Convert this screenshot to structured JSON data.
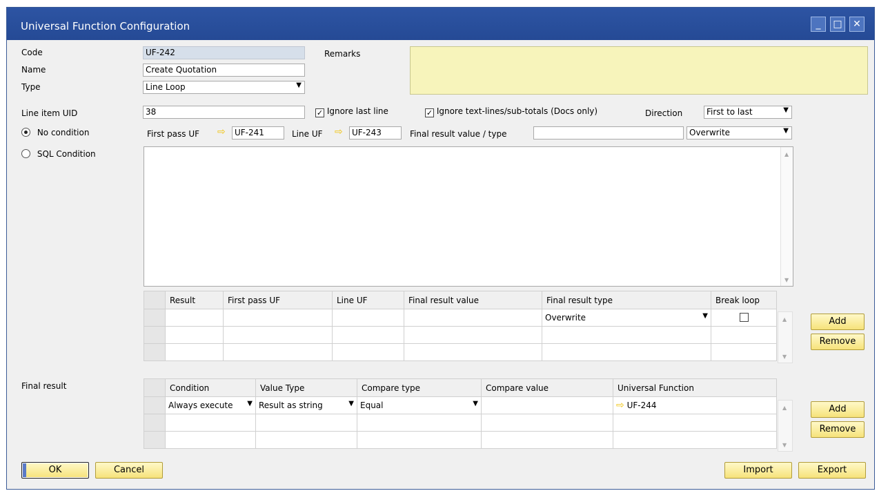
{
  "window": {
    "title": "Universal Function Configuration",
    "minimize": "_",
    "maximize": "□",
    "close": "✕"
  },
  "header": {
    "code_label": "Code",
    "code_value": "UF-242",
    "name_label": "Name",
    "name_value": "Create Quotation",
    "type_label": "Type",
    "type_value": "Line Loop",
    "remarks_label": "Remarks",
    "remarks_value": ""
  },
  "loop": {
    "line_item_uid_label": "Line item UID",
    "line_item_uid_value": "38",
    "ignore_last_line_label": "Ignore last line",
    "ignore_last_line_checked": true,
    "ignore_text_lines_label": "Ignore text-lines/sub-totals (Docs only)",
    "ignore_text_lines_checked": true,
    "direction_label": "Direction",
    "direction_value": "First to last",
    "no_condition_label": "No condition",
    "sql_condition_label": "SQL Condition",
    "selected_condition": "no_condition",
    "first_pass_label": "First pass UF",
    "first_pass_value": "UF-241",
    "line_uf_label": "Line UF",
    "line_uf_value": "UF-243",
    "final_value_label": "Final result value / type",
    "final_value_value": "",
    "final_type_value": "Overwrite",
    "sql_text": ""
  },
  "result_grid": {
    "columns": [
      "Result",
      "First pass UF",
      "Line UF",
      "Final result value",
      "Final result type",
      "Break loop"
    ],
    "rows": [
      {
        "result": "",
        "first_pass": "",
        "line_uf": "",
        "final_value": "",
        "final_type": "Overwrite",
        "break_loop": false
      },
      {
        "result": "",
        "first_pass": "",
        "line_uf": "",
        "final_value": "",
        "final_type": "",
        "break_loop": null
      },
      {
        "result": "",
        "first_pass": "",
        "line_uf": "",
        "final_value": "",
        "final_type": "",
        "break_loop": null
      }
    ],
    "add_label": "Add",
    "remove_label": "Remove"
  },
  "final_result": {
    "label": "Final result",
    "columns": [
      "Condition",
      "Value Type",
      "Compare type",
      "Compare value",
      "Universal Function"
    ],
    "rows": [
      {
        "condition": "Always execute",
        "value_type": "Result as string",
        "compare_type": "Equal",
        "compare_value": "",
        "uf": "UF-244"
      },
      {
        "condition": "",
        "value_type": "",
        "compare_type": "",
        "compare_value": "",
        "uf": ""
      },
      {
        "condition": "",
        "value_type": "",
        "compare_type": "",
        "compare_value": "",
        "uf": ""
      }
    ],
    "add_label": "Add",
    "remove_label": "Remove"
  },
  "footer": {
    "ok_label": "OK",
    "cancel_label": "Cancel",
    "import_label": "Import",
    "export_label": "Export"
  },
  "colors": {
    "titlebar": "#2d54a3",
    "remarks_bg": "#f7f4bb",
    "button_bg": "#f6e27a",
    "link_arrow": "#f1c40f"
  }
}
